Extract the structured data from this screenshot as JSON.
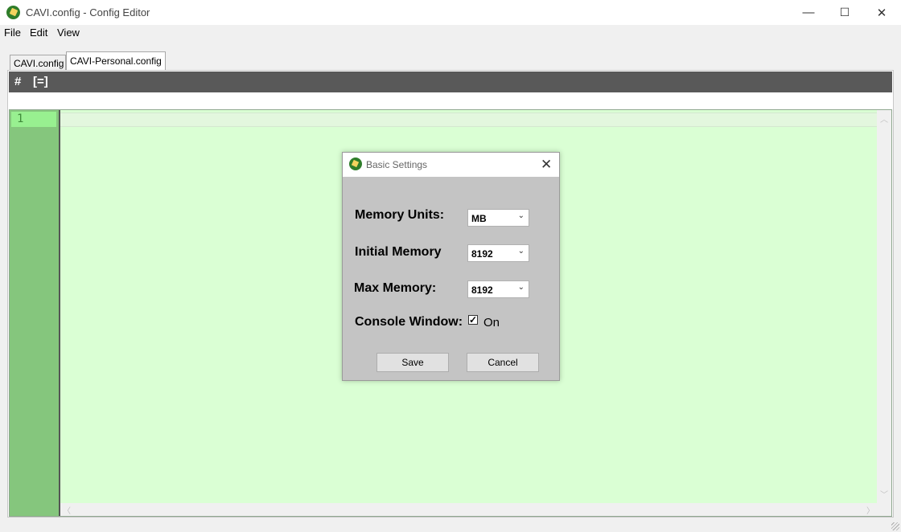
{
  "window": {
    "title": "CAVI.config - Config Editor",
    "controls": {
      "minimize": "—",
      "maximize": "☐",
      "close": "✕"
    }
  },
  "menu": {
    "items": [
      "File",
      "Edit",
      "View"
    ]
  },
  "tabs": [
    {
      "label": "CAVI.config",
      "active": false
    },
    {
      "label": "CAVI-Personal.config",
      "active": true
    }
  ],
  "toolbar": {
    "hash_label": "#",
    "bracket_label": "[=]"
  },
  "editor": {
    "line_numbers": [
      "1"
    ],
    "background_color": "#daffd4",
    "gutter_color": "#85c67d"
  },
  "dialog": {
    "title": "Basic Settings",
    "close_glyph": "✕",
    "memory_units": {
      "label": "Memory Units:",
      "value": "MB"
    },
    "initial_memory": {
      "label": "Initial Memory",
      "value": "8192"
    },
    "max_memory": {
      "label": "Max Memory:",
      "value": "8192"
    },
    "console_window": {
      "label": "Console Window:",
      "checked": true,
      "check_glyph": "✓",
      "option_label": "On"
    },
    "save_label": "Save",
    "cancel_label": "Cancel"
  }
}
